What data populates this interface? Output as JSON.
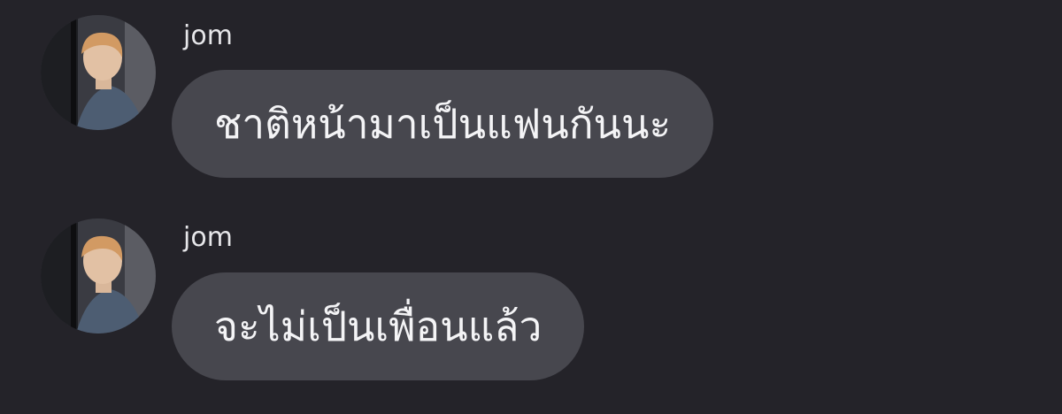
{
  "messages": [
    {
      "sender": "jom",
      "text": "ชาติหน้ามาเป็นแฟนกันนะ",
      "avatar_icon": "profile-photo-icon"
    },
    {
      "sender": "jom",
      "text": "จะไม่เป็นเพื่อนแล้ว",
      "avatar_icon": "profile-photo-icon"
    }
  ],
  "colors": {
    "background": "#242329",
    "bubble": "#47474e",
    "text": "#f4f4f6",
    "sender": "#e6e6e9"
  }
}
